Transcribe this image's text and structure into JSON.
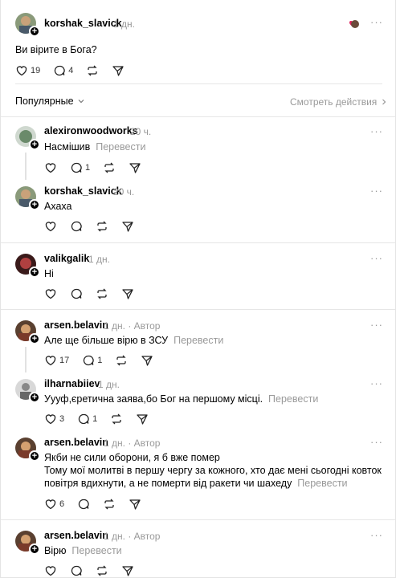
{
  "post": {
    "author": "korshak_slavick",
    "time": "1 дн.",
    "text": "Ви вірите в Бога?",
    "likes": "19",
    "replies": "4"
  },
  "sort": {
    "label": "Популярные",
    "view_activity": "Смотреть действия"
  },
  "translate_label": "Перевести",
  "author_badge": "· Автор",
  "comments": [
    {
      "author": "alexironwoodworks",
      "time": "20 ч.",
      "text": "Насмішив",
      "replies": "1"
    },
    {
      "author": "korshak_slavick",
      "time": "20 ч.",
      "text": "Ахаха"
    },
    {
      "author": "valikgalik",
      "time": "1 дн.",
      "text": "Ні"
    },
    {
      "author": "arsen.belavin",
      "time": "1 дн.",
      "text": "Але ще більше вірю в ЗСУ",
      "likes": "17",
      "replies": "1"
    },
    {
      "author": "ilharnabiiev",
      "time": "1 дн.",
      "text": "Уууф,єретична заява,бо Бог на першому місці.",
      "likes": "3",
      "replies": "1"
    },
    {
      "author": "arsen.belavin",
      "time": "1 дн.",
      "text_line1": "Якби не сили оборони, я б вже помер",
      "text_line2": "Тому мої молитві в першу чергу за кожного, хто дає мені сьогодні ковток",
      "text_line3": "повітря вдихнути, а не померти від ракети чи шахеду",
      "likes": "6"
    },
    {
      "author": "arsen.belavin",
      "time": "1 дн.",
      "text": "Вірю"
    }
  ],
  "icons": {
    "like": "heart-icon",
    "reply": "comment-icon",
    "repost": "repost-icon",
    "share": "send-icon",
    "more": "more-icon",
    "plus": "follow-plus-icon"
  },
  "colors": {
    "muted": "#999999",
    "divider": "#e6e6e6",
    "liked_red": "#e0245e"
  }
}
